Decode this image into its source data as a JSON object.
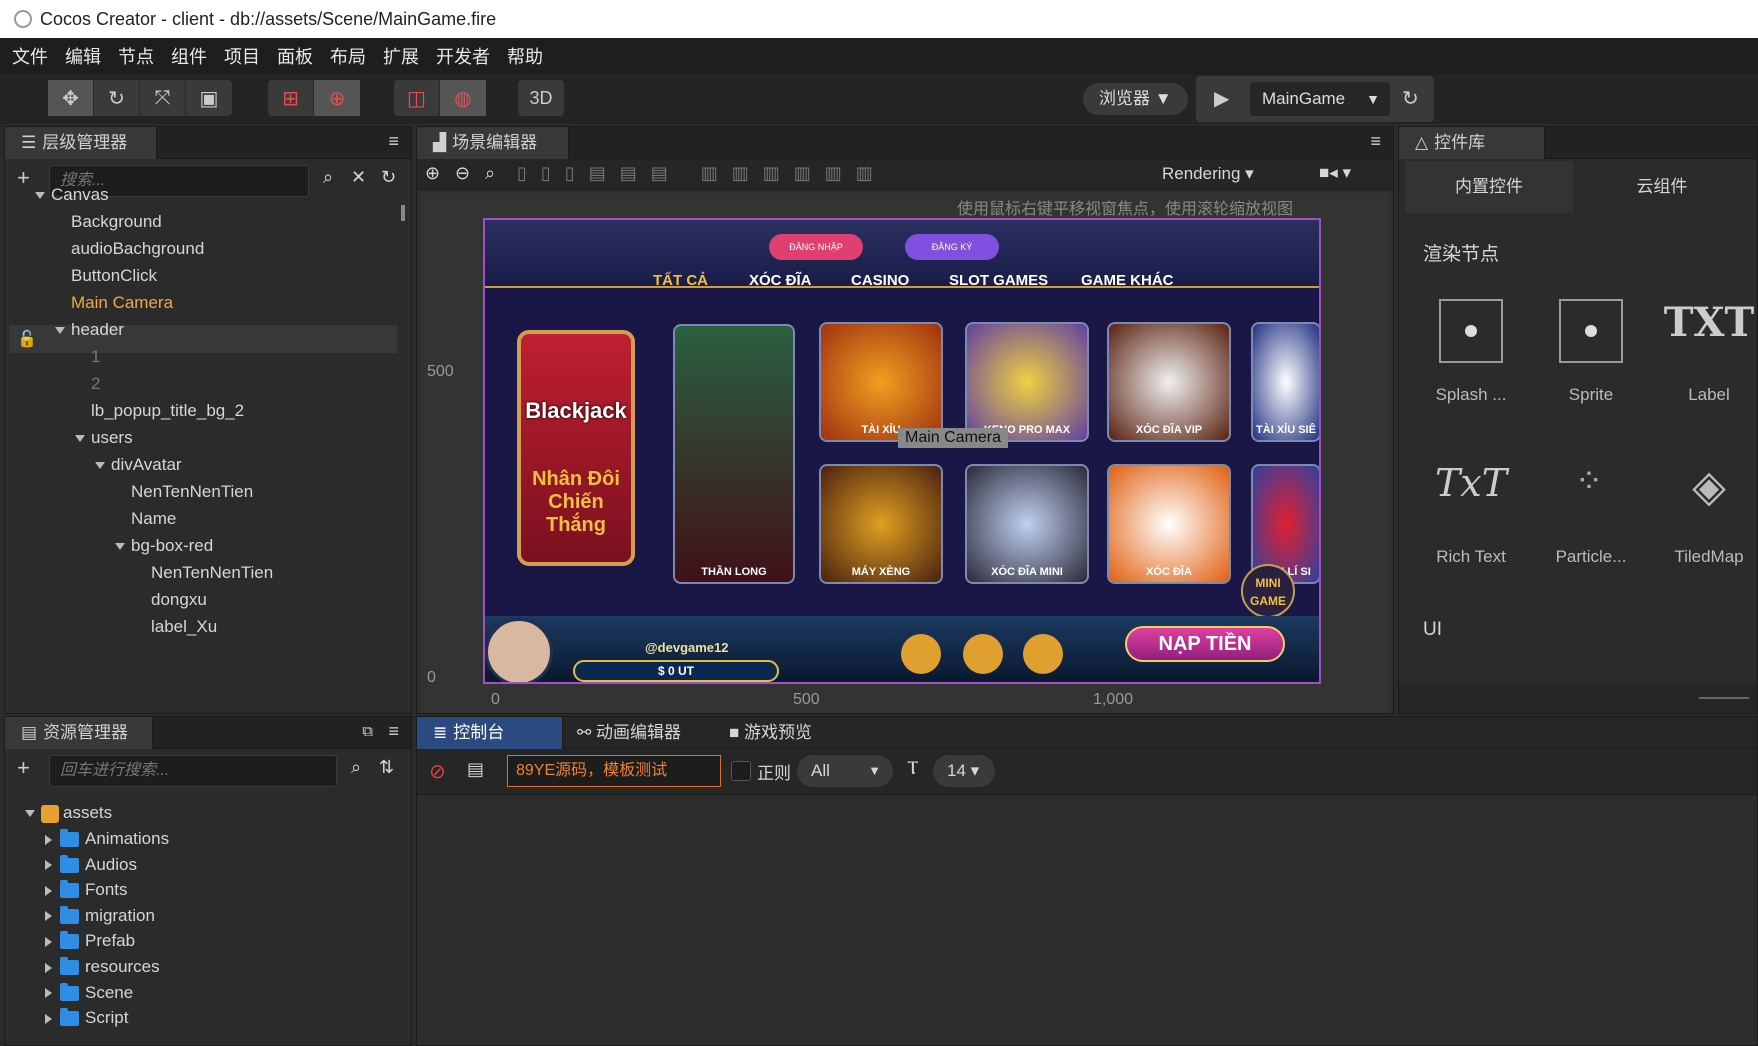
{
  "window": {
    "title": "Cocos Creator - client - db://assets/Scene/MainGame.fire"
  },
  "menu": [
    "文件",
    "编辑",
    "节点",
    "组件",
    "项目",
    "面板",
    "布局",
    "扩展",
    "开发者",
    "帮助"
  ],
  "toolbar": {
    "mode3d": "3D",
    "platform": "浏览器 ▼",
    "scene_select": "MainGame",
    "play_icon": "play-icon",
    "refresh_icon": "refresh-icon"
  },
  "hierarchy": {
    "tab": "层级管理器",
    "search_placeholder": "搜索...",
    "nodes": [
      {
        "label": "Canvas",
        "depth": 0,
        "expanded": true
      },
      {
        "label": "Background",
        "depth": 1
      },
      {
        "label": "audioBachground",
        "depth": 1
      },
      {
        "label": "ButtonClick",
        "depth": 1
      },
      {
        "label": "Main Camera",
        "depth": 1,
        "selected": true
      },
      {
        "label": "header",
        "depth": 1,
        "expanded": true
      },
      {
        "label": "1",
        "depth": 2,
        "dim": true
      },
      {
        "label": "2",
        "depth": 2,
        "dim": true
      },
      {
        "label": "lb_popup_title_bg_2",
        "depth": 2
      },
      {
        "label": "users",
        "depth": 2,
        "expanded": true
      },
      {
        "label": "divAvatar",
        "depth": 3,
        "expanded": true
      },
      {
        "label": "NenTenNenTien",
        "depth": 4
      },
      {
        "label": "Name",
        "depth": 4
      },
      {
        "label": "bg-box-red",
        "depth": 4,
        "expanded": true
      },
      {
        "label": "NenTenNenTien",
        "depth": 5
      },
      {
        "label": "dongxu",
        "depth": 5
      },
      {
        "label": "label_Xu",
        "depth": 5
      }
    ]
  },
  "assets": {
    "tab": "资源管理器",
    "search_placeholder": "回车进行搜索...",
    "root": "assets",
    "folders": [
      "Animations",
      "Audios",
      "Fonts",
      "migration",
      "Prefab",
      "resources",
      "Scene",
      "Script"
    ]
  },
  "scene": {
    "tab": "场景编辑器",
    "hint": "使用鼠标右键平移视窗焦点，使用滚轮缩放视图",
    "rendering": "Rendering",
    "ruler_y": [
      "500",
      "0"
    ],
    "ruler_x": [
      "0",
      "500",
      "1,000"
    ],
    "camera_label": "Main Camera",
    "game": {
      "buttons": [
        "ĐĂNG NHẬP",
        "ĐĂNG KÝ"
      ],
      "tabs": [
        "TẤT CẢ",
        "XÓC ĐĨA",
        "CASINO",
        "SLOT GAMES",
        "GAME KHÁC"
      ],
      "promo": [
        "Blackjack",
        "Nhân Đôi",
        "Chiến Thắng"
      ],
      "tiles": [
        "THẦN LONG",
        "TÀI XỈU",
        "KENO PRO MAX",
        "XÓC ĐĨA VIP",
        "TÀI XỈU SIÊ",
        "MÁY XÈNG",
        "XÓC ĐĨA MINI",
        "XÓC ĐĨA",
        "MINI LÍ SI"
      ],
      "minigame": "MINI GAME",
      "username": "@devgame12",
      "balance": "$ 0 UT",
      "nap_tien": "NẠP TIỀN"
    }
  },
  "controls": {
    "tab": "控件库",
    "subtabs": [
      "内置控件",
      "云组件"
    ],
    "section1": "渲染节点",
    "section2": "UI",
    "items": [
      {
        "label": "Splash ...",
        "icon": "splash-sprite-icon"
      },
      {
        "label": "Sprite",
        "icon": "sprite-icon"
      },
      {
        "label": "Label",
        "icon": "label-icon",
        "glyph": "TXT"
      },
      {
        "label": "Rich Text",
        "icon": "rich-text-icon",
        "glyph": "TxT"
      },
      {
        "label": "Particle...",
        "icon": "particle-icon"
      },
      {
        "label": "TiledMap",
        "icon": "tiledmap-icon"
      }
    ]
  },
  "bottom": {
    "tabs": [
      "控制台",
      "动画编辑器",
      "游戏预览"
    ],
    "filter_text": "89YE源码，模板测试",
    "regex_label": "正则",
    "level": "All",
    "font_size": "14"
  }
}
